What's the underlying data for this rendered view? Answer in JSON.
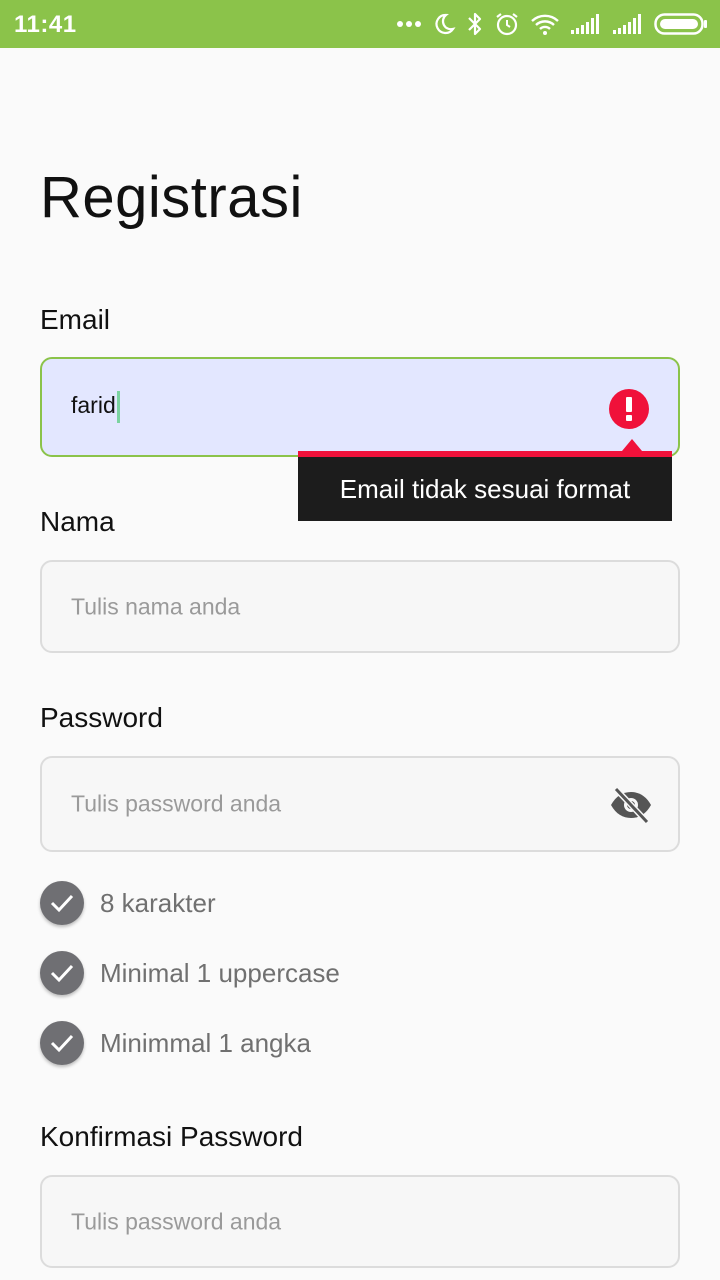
{
  "status_bar": {
    "time": "11:41",
    "icons": [
      "more-icon",
      "moon-icon",
      "bluetooth-icon",
      "alarm-icon",
      "wifi-icon",
      "signal-icon",
      "signal-icon-2",
      "battery-icon"
    ]
  },
  "page": {
    "title": "Registrasi"
  },
  "email": {
    "label": "Email",
    "value": "farid",
    "error_message": "Email tidak sesuai format"
  },
  "nama": {
    "label": "Nama",
    "placeholder": "Tulis nama anda"
  },
  "password": {
    "label": "Password",
    "placeholder": "Tulis password anda",
    "requirements": [
      {
        "text": "8 karakter"
      },
      {
        "text": "Minimal 1 uppercase"
      },
      {
        "text": "Minimmal 1 angka"
      }
    ]
  },
  "konfirmasi": {
    "label": "Konfirmasi Password",
    "placeholder": "Tulis password anda"
  },
  "colors": {
    "status_bar": "#8bc34a",
    "error": "#f0113a",
    "email_field_bg": "#e3e7ff"
  }
}
